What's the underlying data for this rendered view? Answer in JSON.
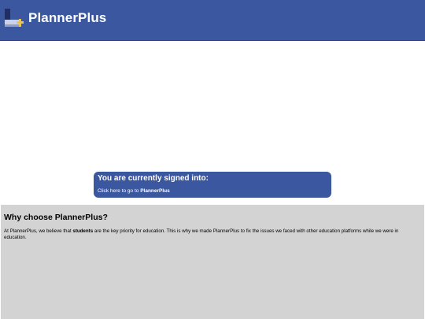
{
  "header": {
    "brand": "PlannerPlus",
    "logo_icon": "planner-plus-logo-icon"
  },
  "signin": {
    "title": "You are currently signed into:",
    "link_prefix": "Click here to go to ",
    "link_target": "PlannerPlus"
  },
  "why": {
    "title": "Why choose PlannerPlus?",
    "body_part1": "At PlannerPlus, we believe that ",
    "body_bold": "students",
    "body_part2": " are the key priority for education. This is why we made PlannerPlus to fix the issues we faced with other education platforms while we were in education."
  },
  "colors": {
    "header_bg": "#3a57a0",
    "card_bg": "#3a57a0",
    "section_bg": "#d3d3d3",
    "logo_accent": "#e8c35a"
  }
}
